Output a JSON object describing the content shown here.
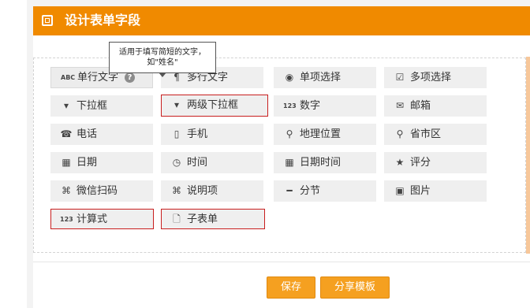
{
  "header": {
    "title": "设计表单字段",
    "icon": "form-icon"
  },
  "tooltip": {
    "line1": "适用于填写简短的文字，",
    "line2": "如\"姓名\""
  },
  "fields": [
    {
      "label": "单行文字",
      "icon": "ABC"
    },
    {
      "label": "多行文字",
      "icon": "¶"
    },
    {
      "label": "单项选择",
      "icon": "◉"
    },
    {
      "label": "多项选择",
      "icon": "☑"
    },
    {
      "label": "下拉框",
      "icon": "▾"
    },
    {
      "label": "两级下拉框",
      "icon": "▾"
    },
    {
      "label": "数字",
      "icon": "123"
    },
    {
      "label": "邮箱",
      "icon": "✉"
    },
    {
      "label": "电话",
      "icon": "☎"
    },
    {
      "label": "手机",
      "icon": "▯"
    },
    {
      "label": "地理位置",
      "icon": "⚲"
    },
    {
      "label": "省市区",
      "icon": "⚲"
    },
    {
      "label": "日期",
      "icon": "▦"
    },
    {
      "label": "时间",
      "icon": "◷"
    },
    {
      "label": "日期时间",
      "icon": "▦"
    },
    {
      "label": "评分",
      "icon": "★"
    },
    {
      "label": "微信扫码",
      "icon": "⌘"
    },
    {
      "label": "说明项",
      "icon": "⌘"
    },
    {
      "label": "分节",
      "icon": "━"
    },
    {
      "label": "图片",
      "icon": "▣"
    },
    {
      "label": "计算式",
      "icon": "123"
    },
    {
      "label": "子表单",
      "icon": "🗋"
    }
  ],
  "help_icon": "?",
  "actions": {
    "save": "保存",
    "share_template": "分享模板"
  },
  "colors": {
    "header": "#f08a00",
    "button": "#f5a020",
    "highlight_border": "#c81e1e"
  }
}
